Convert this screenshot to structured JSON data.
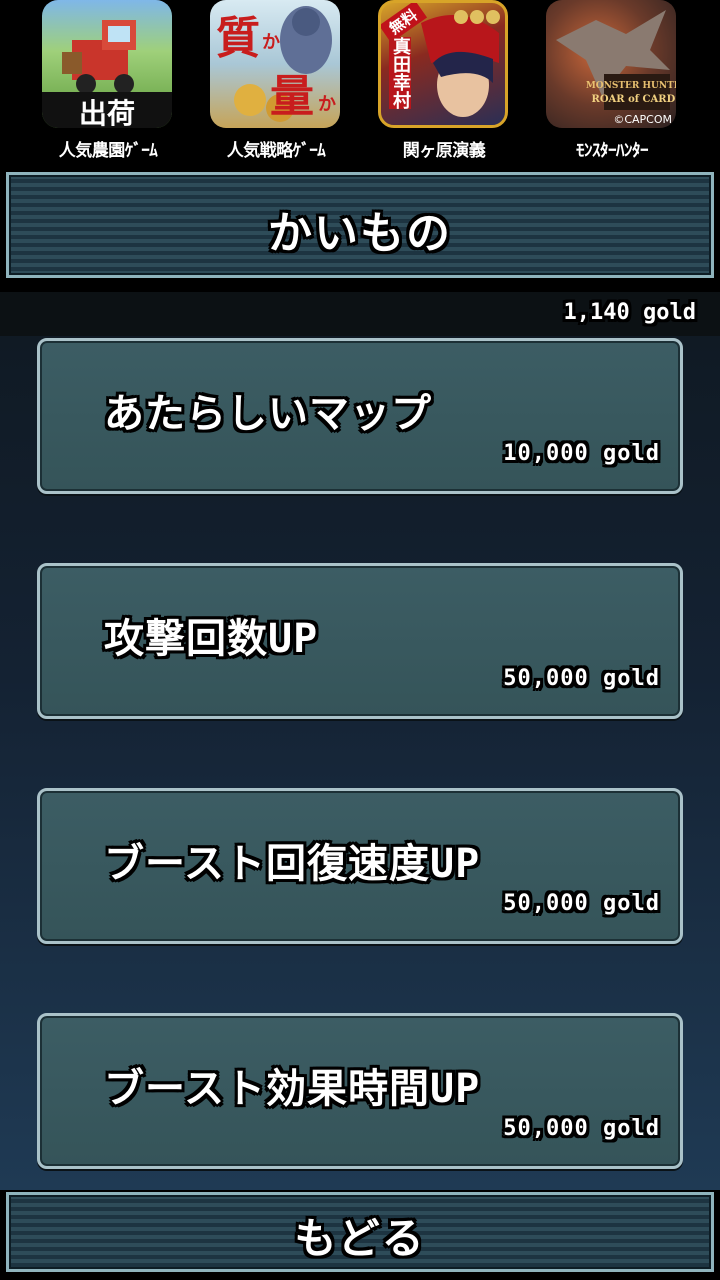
{
  "ads": [
    {
      "label": "人気農園ｹﾞｰﾑ",
      "icon_text": "出荷",
      "icon": "farm-game-icon"
    },
    {
      "label": "人気戦略ｹﾞｰﾑ",
      "icon_text_a": "質",
      "icon_text_b": "量",
      "icon_text_small": "か",
      "icon": "strategy-game-icon"
    },
    {
      "label": "関ヶ原演義",
      "icon_badge": "無料",
      "icon_vertical": "真田幸村",
      "icon": "sekigahara-game-icon"
    },
    {
      "label": "ﾓﾝｽﾀｰﾊﾝﾀｰ",
      "icon_caption": "©CAPCOM",
      "icon": "monster-hunter-icon"
    }
  ],
  "header": {
    "title": "かいもの"
  },
  "gold": {
    "amount": "1,140 gold"
  },
  "items": [
    {
      "name": "あたらしいマップ",
      "price": "10,000 gold"
    },
    {
      "name": "攻撃回数UP",
      "price": "50,000 gold"
    },
    {
      "name": "ブースト回復速度UP",
      "price": "50,000 gold"
    },
    {
      "name": "ブースト効果時間UP",
      "price": "50,000 gold"
    }
  ],
  "footer": {
    "back_label": "もどる"
  }
}
